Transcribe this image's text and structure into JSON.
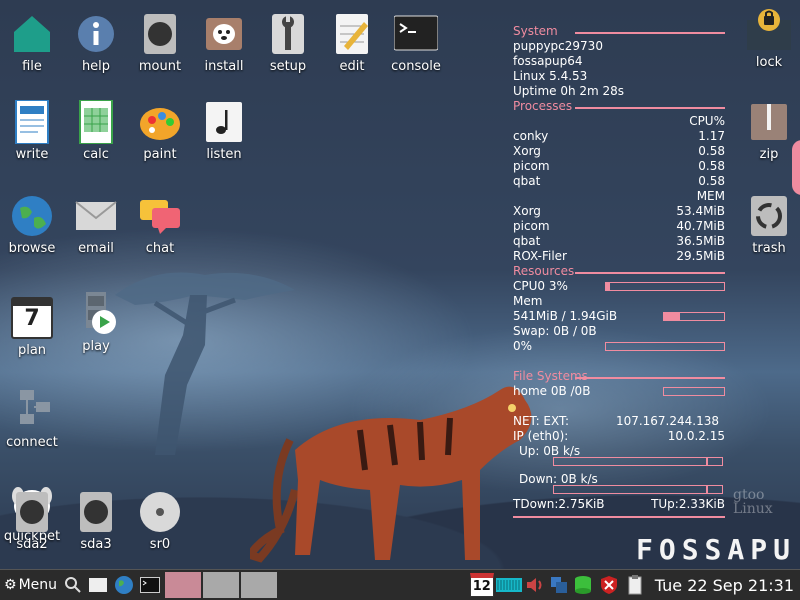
{
  "desktop": {
    "icons": {
      "file": "file",
      "help": "help",
      "mount": "mount",
      "install": "install",
      "setup": "setup",
      "edit": "edit",
      "console": "console",
      "write": "write",
      "calc": "calc",
      "paint": "paint",
      "listen": "listen",
      "browse": "browse",
      "email": "email",
      "chat": "chat",
      "plan": "plan",
      "play": "play",
      "connect": "connect",
      "quickpet": "quickpet",
      "sda2": "sda2",
      "sda3": "sda3",
      "sr0": "sr0",
      "lock": "lock",
      "zip": "zip",
      "trash": "trash"
    },
    "plan_day": "7",
    "brand": "FOSSAPU",
    "watermark": "gtoo\nLinux"
  },
  "conky": {
    "system": {
      "heading": "System",
      "hostname": "puppypc29730",
      "distro": "fossapup64",
      "kernel": "Linux 5.4.53",
      "uptime": "Uptime 0h 2m 28s"
    },
    "processes": {
      "heading": "Processes",
      "cpu_header": "CPU%",
      "cpu": [
        {
          "name": "conky",
          "value": "1.17"
        },
        {
          "name": "Xorg",
          "value": "0.58"
        },
        {
          "name": "picom",
          "value": "0.58"
        },
        {
          "name": "qbat",
          "value": "0.58"
        }
      ],
      "mem_header": "MEM",
      "mem": [
        {
          "name": "Xorg",
          "value": "53.4MiB"
        },
        {
          "name": "picom",
          "value": "40.7MiB"
        },
        {
          "name": "qbat",
          "value": "36.5MiB"
        },
        {
          "name": "ROX-Filer",
          "value": "29.5MiB"
        }
      ]
    },
    "resources": {
      "heading": "Resources",
      "cpu_label": "CPU0 3%",
      "cpu_fraction": 0.03,
      "mem_label": "Mem",
      "mem_value": "541MiB / 1.94GiB",
      "mem_fraction": 0.27,
      "swap_label": "Swap: 0B   / 0B",
      "swap_percent": "0%",
      "swap_fraction": 0
    },
    "filesystems": {
      "heading": "File Systems",
      "home": "home 0B  /0B",
      "home_fraction": 0
    },
    "network": {
      "ext_label": "NET: EXT:",
      "ext_ip": "107.167.244.138",
      "ip_label": "IP (eth0):",
      "ip": "10.0.2.15",
      "up": "Up: 0B   k/s",
      "down": "Down: 0B  k/s",
      "tdown": "TDown:2.75KiB",
      "tup": "TUp:2.33KiB"
    }
  },
  "taskbar": {
    "menu_label": "Menu",
    "calendar_day": "12",
    "datetime": "Tue 22 Sep 21:31",
    "colors": {
      "slot1": "#c98a97",
      "slot2": "#a9a9a9",
      "slot3": "#a9a9a9"
    }
  }
}
